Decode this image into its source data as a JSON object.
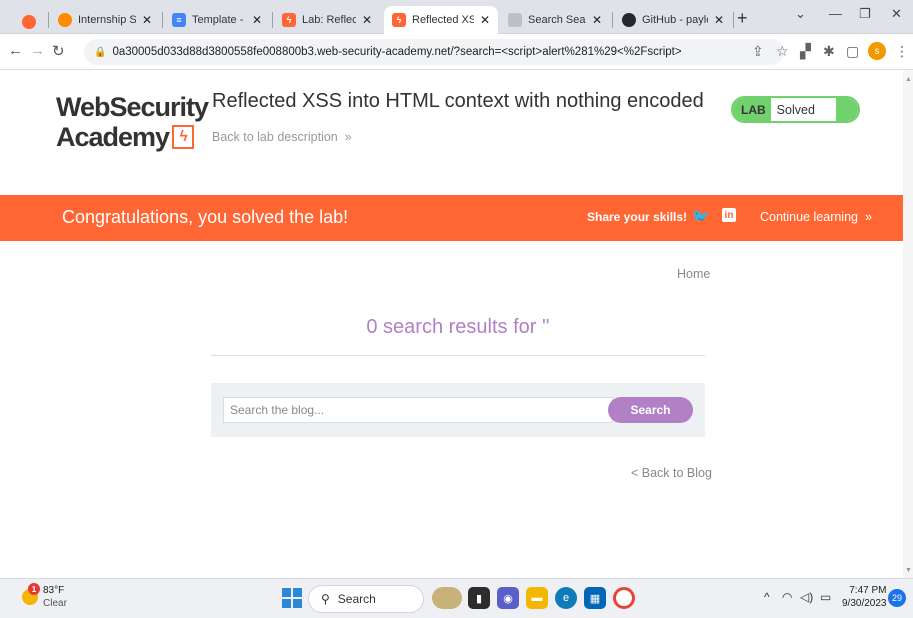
{
  "browser": {
    "tabs": [
      {
        "label": "Internship Studio",
        "icon_color": "#ff8a00"
      },
      {
        "label": "Template - Goog",
        "icon_color": "#4285f4"
      },
      {
        "label": "Lab: Reflected XS",
        "icon_color": "#ff6633"
      },
      {
        "label": "Reflected XSS int",
        "icon_color": "#ff6633"
      },
      {
        "label": "Search Search",
        "icon_color": "#9aa0a6"
      },
      {
        "label": "GitHub - payload",
        "icon_color": "#24292e"
      }
    ],
    "url": "0a30005d033d88d3800558fe008800b3.web-security-academy.net/?search=<script>alert%281%29<%2Fscript>",
    "profile_initial": "s"
  },
  "header": {
    "logo_line1": "WebSecurity",
    "logo_line2": "Academy",
    "lab_title": "Reflected XSS into HTML context with nothing encoded",
    "back_to_description": "Back to lab description",
    "lab_badge": "LAB",
    "lab_status": "Solved",
    "accent": "#70d16d"
  },
  "banner": {
    "message": "Congratulations, you solved the lab!",
    "share": "Share your skills!",
    "continue": "Continue learning",
    "color": "#ff6633"
  },
  "main": {
    "home_link": "Home",
    "results_heading": "0 search results for ''",
    "search_placeholder": "Search the blog...",
    "search_button": "Search",
    "back_to_blog": "< Back to Blog",
    "accent": "#b180c5"
  },
  "taskbar": {
    "temperature": "83°F",
    "weather": "Clear",
    "weather_badge": "1",
    "search": "Search",
    "time": "7:47 PM",
    "date": "9/30/2023",
    "notifications": "29"
  }
}
